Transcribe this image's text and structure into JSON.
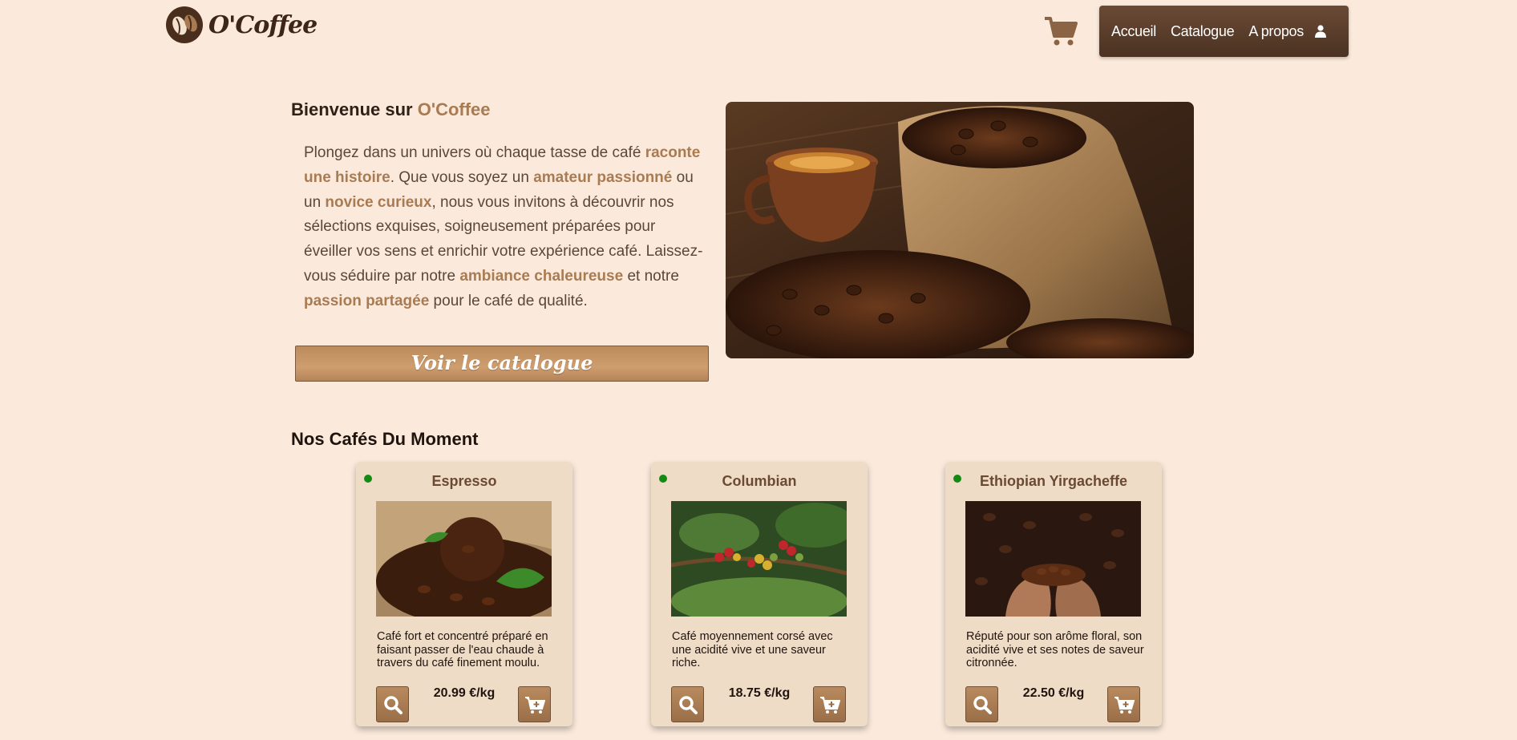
{
  "header": {
    "brand": "O'Coffee",
    "nav": [
      {
        "label": "Accueil"
      },
      {
        "label": "Catalogue"
      },
      {
        "label": "A propos"
      }
    ],
    "icons": {
      "logo": "coffee-bean-icon",
      "cart": "cart-icon",
      "user": "user-icon"
    }
  },
  "hero": {
    "welcome_prefix": "Bienvenue sur ",
    "welcome_brand": "O'Coffee",
    "intro": [
      {
        "t": "Plongez dans un univers où chaque tasse de café ",
        "b": false
      },
      {
        "t": "raconte une histoire",
        "b": true
      },
      {
        "t": ". Que vous soyez un ",
        "b": false
      },
      {
        "t": "amateur passionné",
        "b": true
      },
      {
        "t": " ou un ",
        "b": false
      },
      {
        "t": "novice curieux",
        "b": true
      },
      {
        "t": ", nous vous invitons à découvrir nos sélections exquises, soigneusement préparées pour éveiller vos sens et enrichir votre expérience café. Laissez-vous séduire par notre ",
        "b": false
      },
      {
        "t": "ambiance chaleureuse",
        "b": true
      },
      {
        "t": " et notre ",
        "b": false
      },
      {
        "t": "passion partagée",
        "b": true
      },
      {
        "t": " pour le café de qualité.",
        "b": false
      }
    ],
    "cta_label": "Voir le catalogue"
  },
  "products": {
    "title": "Nos Cafés Du Moment",
    "items": [
      {
        "name": "Espresso",
        "description": "Café fort et concentré préparé en faisant passer de l'eau chaude à travers du café finement moulu.",
        "price": "20.99 €/kg",
        "available": true
      },
      {
        "name": "Columbian",
        "description": "Café moyennement corsé avec une acidité vive et une saveur riche.",
        "price": "18.75 €/kg",
        "available": true
      },
      {
        "name": "Ethiopian Yirgacheffe",
        "description": "Réputé pour son arôme floral, son acidité vive et ses notes de saveur citronnée.",
        "price": "22.50 €/kg",
        "available": true
      }
    ]
  },
  "colors": {
    "background": "#fbeadc",
    "accent": "#a97b52",
    "nav_bg": "#5a3d2a",
    "card_bg": "#efdcc7",
    "available_dot": "#148a14"
  }
}
